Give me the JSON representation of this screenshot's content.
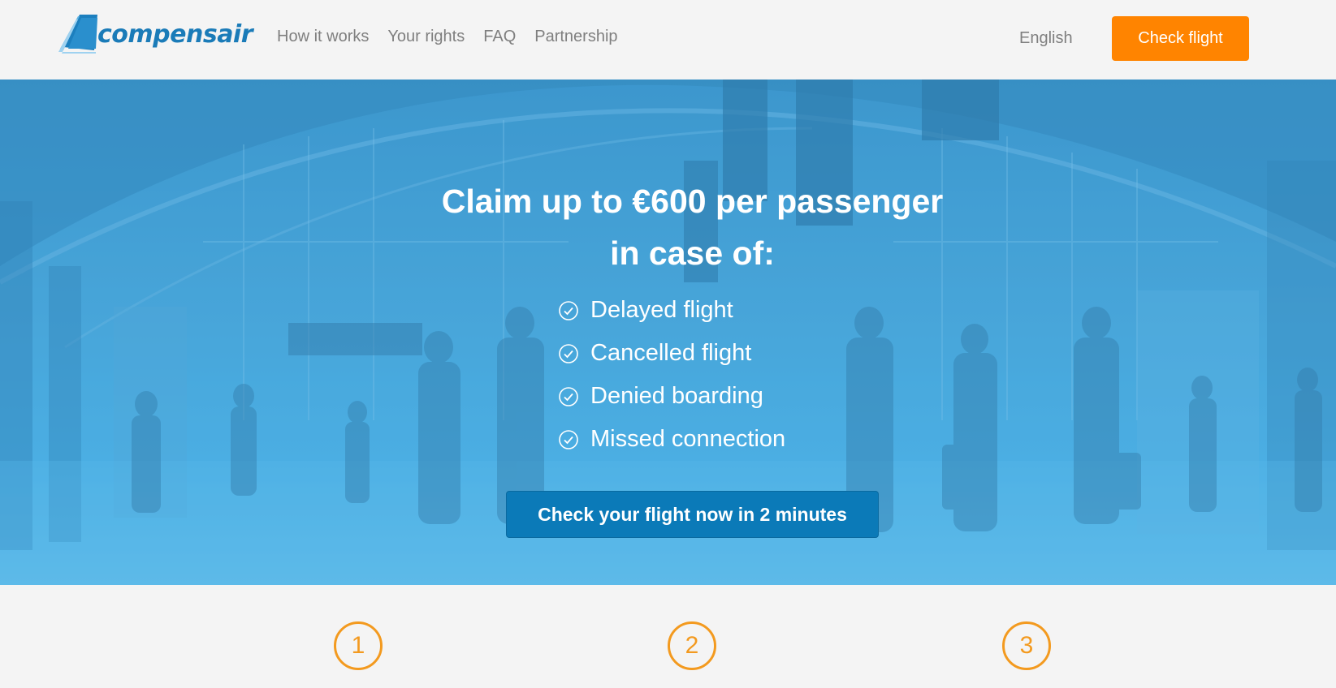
{
  "header": {
    "logo_text": "compensair",
    "nav": [
      "How it works",
      "Your rights",
      "FAQ",
      "Partnership"
    ],
    "language": "English",
    "check_flight_label": "Check flight"
  },
  "hero": {
    "title_line1": "Claim up to €600 per passenger",
    "title_line2": "in case of:",
    "features": [
      "Delayed flight",
      "Cancelled flight",
      "Denied boarding",
      "Missed connection"
    ],
    "cta_label": "Check your flight now in 2 minutes"
  },
  "steps": [
    "1",
    "2",
    "3"
  ],
  "colors": {
    "brand_blue": "#1a7bb8",
    "accent_orange": "#ff8400",
    "step_orange": "#f39a1f",
    "cta_blue": "#0b7ab8"
  },
  "icons": {
    "logo": "logo-wing-icon",
    "feature": "check-circle-icon"
  }
}
